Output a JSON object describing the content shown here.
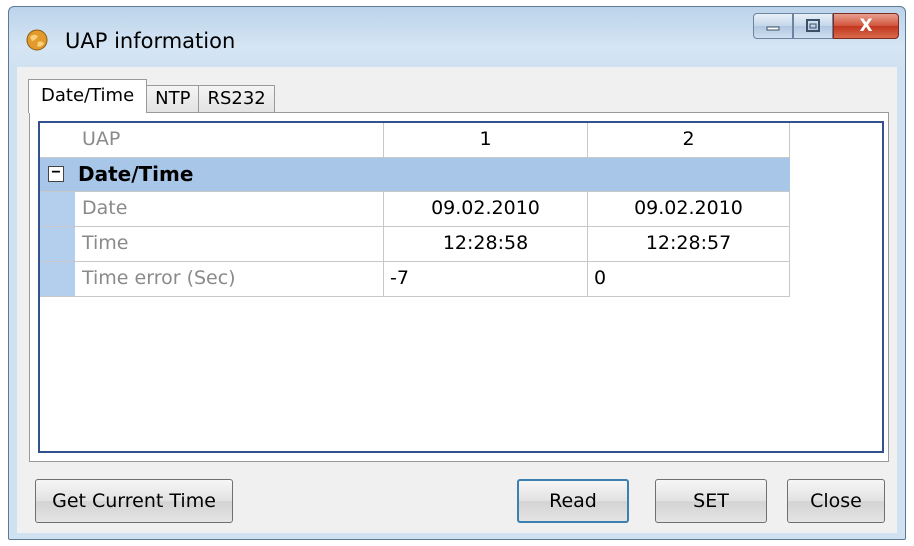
{
  "window": {
    "title": "UAP information"
  },
  "tabs": [
    "Date/Time",
    "NTP",
    "RS232"
  ],
  "grid": {
    "header": {
      "label": "UAP",
      "columns": [
        "1",
        "2"
      ]
    },
    "category": {
      "toggle": "−",
      "title": "Date/Time"
    },
    "rows": [
      {
        "label": "Date",
        "values": [
          "09.02.2010",
          "09.02.2010"
        ]
      },
      {
        "label": "Time",
        "values": [
          "12:28:58",
          "12:28:57"
        ]
      },
      {
        "label": "Time error (Sec)",
        "values": [
          "-7",
          "0"
        ]
      }
    ]
  },
  "buttons": {
    "get_current_time": "Get Current Time",
    "read": "Read",
    "set": "SET",
    "close": "Close"
  },
  "captions": {
    "close_glyph": "X"
  },
  "colors": {
    "accent": "#3c7fb1",
    "category_bg": "#a8c7e8",
    "grid_border": "#33518c"
  }
}
